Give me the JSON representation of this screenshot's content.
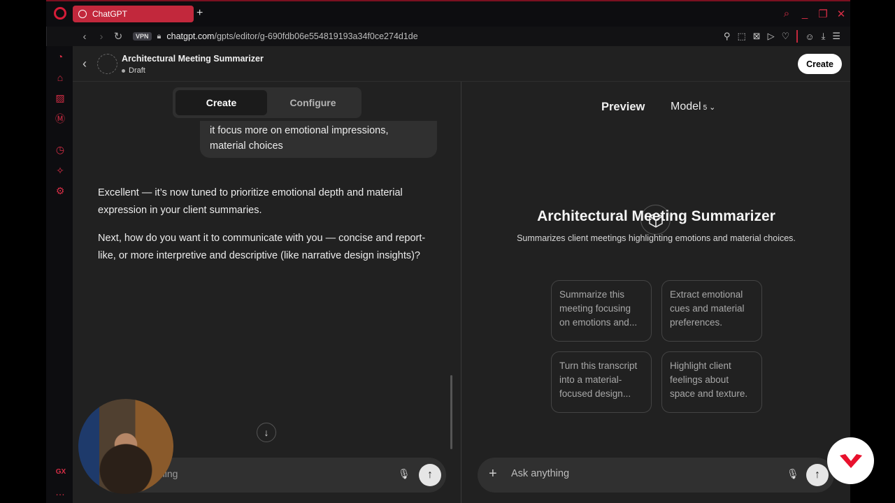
{
  "browser": {
    "tab_title": "ChatGPT",
    "vpn_label": "VPN",
    "url_host": "chatgpt.com",
    "url_path": "/gpts/editor/g-690fdb06e554819193a34f0ce274d1de"
  },
  "header": {
    "gpt_name": "Architectural Meeting Summarizer",
    "status": "Draft",
    "create_button": "Create"
  },
  "editor": {
    "tabs": [
      "Create",
      "Configure"
    ],
    "active_tab": "Create",
    "user_message_tail": "it focus more on emotional impressions, material choices",
    "assistant_messages": [
      "Excellent — it’s now tuned to prioritize emotional depth and material expression in your client summaries.",
      "Next, how do you want it to communicate with you — concise and report-like, or more interpretive and descriptive (like narrative design insights)?"
    ],
    "composer_placeholder_visible": "hing"
  },
  "preview": {
    "label": "Preview",
    "model_label": "Model",
    "model_version": "5",
    "title": "Architectural Meeting Summarizer",
    "description": "Summarizes client meetings highlighting emotions and material choices.",
    "conversation_starters": [
      "Summarize this meeting focusing on emotions and...",
      "Extract emotional cues and material preferences.",
      "Turn this transcript into a material-focused design...",
      "Highlight client feelings about space and texture."
    ],
    "composer_placeholder": "Ask anything"
  },
  "sidebar": {
    "gx_label": "GX"
  },
  "colors": {
    "accent": "#d52d45",
    "tab": "#c2283c",
    "app_bg": "#212121",
    "composer_bg": "#303030"
  }
}
